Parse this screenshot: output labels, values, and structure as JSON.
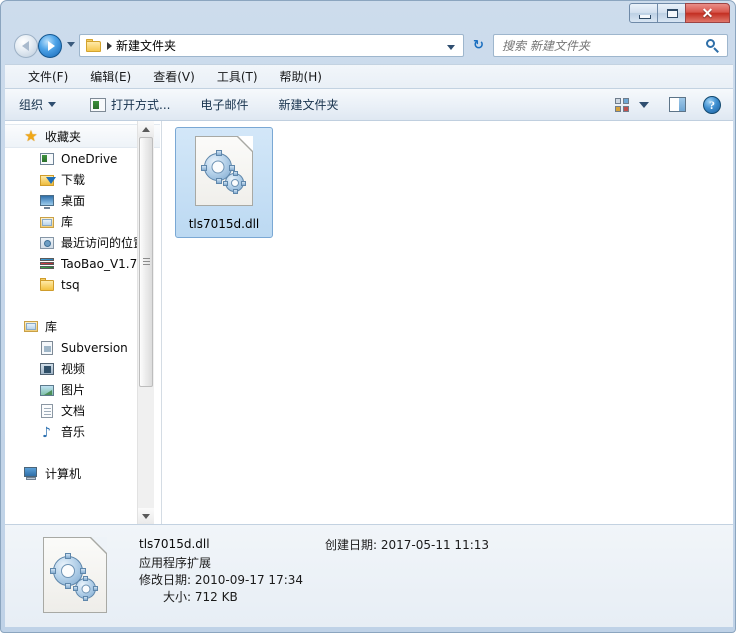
{
  "window": {
    "buttons": {
      "minimize": "minimize",
      "maximize": "restore",
      "close": "✕"
    }
  },
  "address": {
    "back_label": "后退",
    "forward_label": "前进",
    "breadcrumb": "新建文件夹",
    "refresh": "↻"
  },
  "search": {
    "placeholder": "搜索 新建文件夹",
    "value": ""
  },
  "menu": {
    "items": [
      {
        "label": "文件(F)"
      },
      {
        "label": "编辑(E)"
      },
      {
        "label": "查看(V)"
      },
      {
        "label": "工具(T)"
      },
      {
        "label": "帮助(H)"
      }
    ]
  },
  "toolbar": {
    "organize": "组织",
    "open_with": "打开方式...",
    "email": "电子邮件",
    "new_folder": "新建文件夹",
    "help": "?"
  },
  "sidebar": {
    "favorites": {
      "header": "收藏夹",
      "items": [
        {
          "label": "OneDrive",
          "icon": "onedrive-icon"
        },
        {
          "label": "下载",
          "icon": "downloads-icon"
        },
        {
          "label": "桌面",
          "icon": "desktop-icon"
        },
        {
          "label": "库",
          "icon": "library-icon"
        },
        {
          "label": "最近访问的位置",
          "icon": "recent-places-icon"
        },
        {
          "label": "TaoBao_V1.7",
          "icon": "archive-icon"
        },
        {
          "label": "tsq",
          "icon": "folder-icon"
        }
      ]
    },
    "libraries": {
      "header": "库",
      "items": [
        {
          "label": "Subversion",
          "icon": "subversion-icon"
        },
        {
          "label": "视频",
          "icon": "videos-icon"
        },
        {
          "label": "图片",
          "icon": "pictures-icon"
        },
        {
          "label": "文档",
          "icon": "documents-icon"
        },
        {
          "label": "音乐",
          "icon": "music-icon"
        }
      ]
    },
    "computer": {
      "header": "计算机"
    }
  },
  "files": [
    {
      "name": "tls7015d.dll",
      "icon": "dll-icon",
      "selected": true
    }
  ],
  "details": {
    "name": "tls7015d.dll",
    "type": "应用程序扩展",
    "modified_label": "修改日期:",
    "modified_value": "2010-09-17 17:34",
    "size_label": "大小:",
    "size_value": "712 KB",
    "created_label": "创建日期:",
    "created_value": "2017-05-11 11:13"
  },
  "colors": {
    "frame": "#c6d7ea",
    "selection": "#bcd9f2",
    "close_button": "#c32f22",
    "accent": "#1464b4"
  }
}
